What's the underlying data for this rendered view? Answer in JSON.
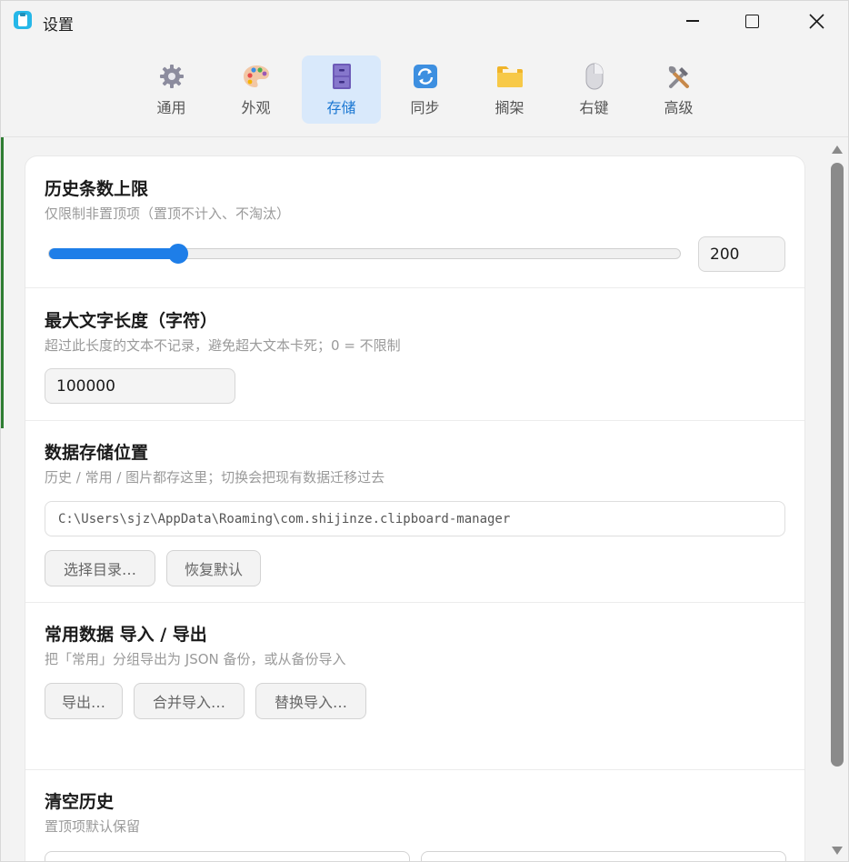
{
  "window": {
    "title": "设置",
    "app_icon": "clipboard-icon",
    "controls": [
      "minimize-icon",
      "maximize-icon",
      "close-icon"
    ]
  },
  "tabs": [
    {
      "label": "通用",
      "icon": "gear-icon",
      "active": false
    },
    {
      "label": "外观",
      "icon": "palette-icon",
      "active": false
    },
    {
      "label": "存储",
      "icon": "storage-cabinet-icon",
      "active": true
    },
    {
      "label": "同步",
      "icon": "sync-icon",
      "active": false
    },
    {
      "label": "搁架",
      "icon": "folder-icon",
      "active": false
    },
    {
      "label": "右键",
      "icon": "mouse-icon",
      "active": false
    },
    {
      "label": "高级",
      "icon": "tools-icon",
      "active": false
    }
  ],
  "accent_color": "#1e7ee8",
  "history_limit": {
    "title": "历史条数上限",
    "desc": "仅限制非置顶项（置顶不计入、不淘汰）",
    "value": "200",
    "slider_fraction": 0.205
  },
  "max_text": {
    "title": "最大文字长度（字符）",
    "desc": "超过此长度的文本不记录，避免超大文本卡死；0 = 不限制",
    "value": "100000"
  },
  "storage_location": {
    "title": "数据存储位置",
    "desc": "历史 / 常用 / 图片都存这里；切换会把现有数据迁移过去",
    "path": "C:\\Users\\sjz\\AppData\\Roaming\\com.shijinze.clipboard-manager",
    "choose_button": "选择目录…",
    "reset_button": "恢复默认"
  },
  "favorites_io": {
    "title": "常用数据 导入 / 导出",
    "desc": "把「常用」分组导出为 JSON 备份，或从备份导入",
    "export_button": "导出…",
    "merge_button": "合并导入…",
    "replace_button": "替换导入…"
  },
  "clear_history": {
    "title": "清空历史",
    "desc": "置顶项默认保留"
  }
}
